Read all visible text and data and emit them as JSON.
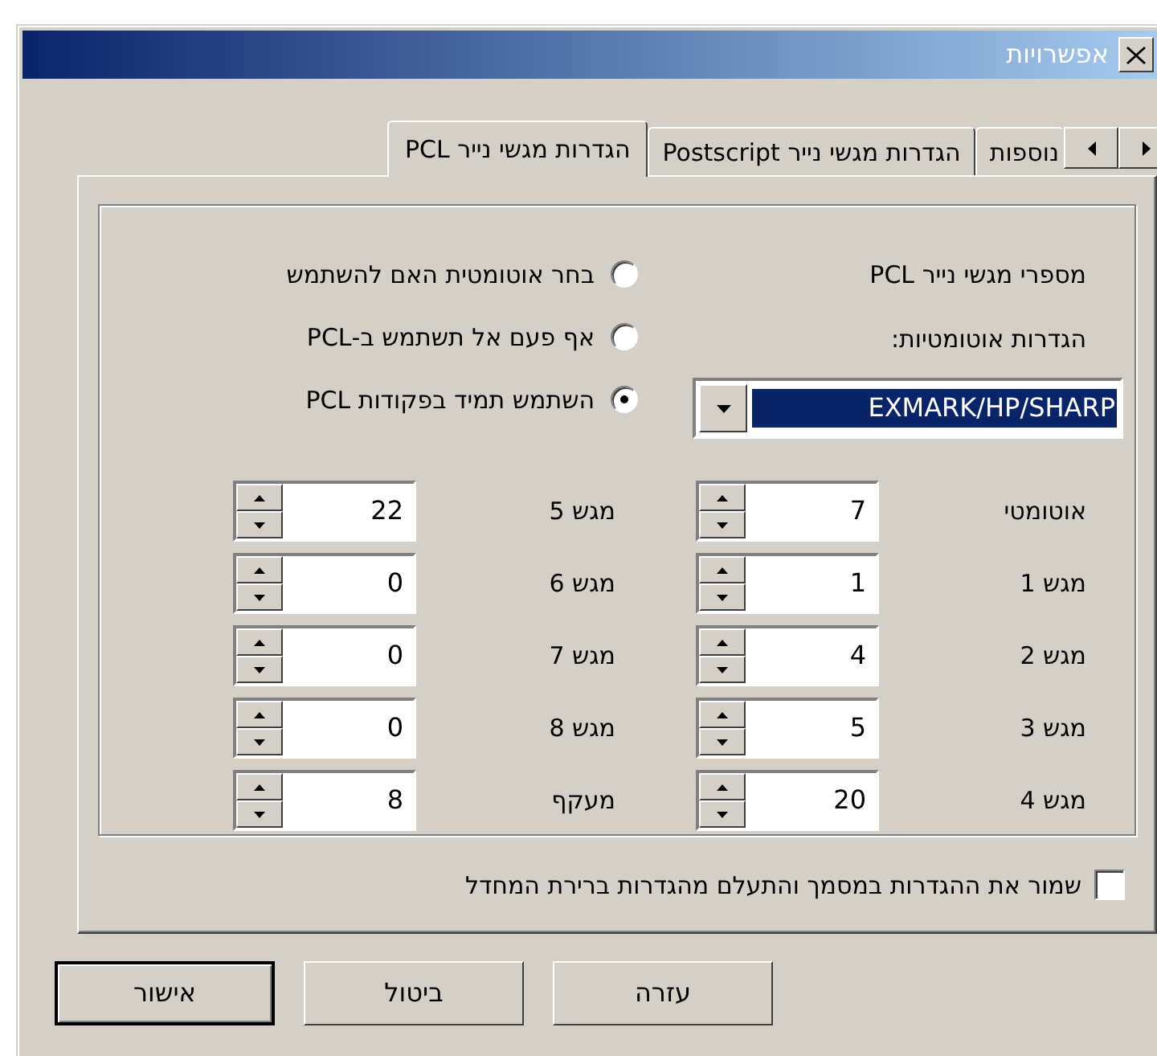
{
  "window": {
    "title": "אפשרויות"
  },
  "tabs": [
    {
      "label": "נוספות",
      "selected": false,
      "cut": true
    },
    {
      "label": "הגדרות מגשי נייר Postscript",
      "selected": false
    },
    {
      "label": "הגדרות מגשי נייר PCL",
      "selected": true
    }
  ],
  "tray_numbers": {
    "title": "מספרי מגשי נייר PCL",
    "auto_label": "הגדרות אוטומטיות:",
    "auto_select": "EXMARK/HP/SHARP",
    "options": [
      {
        "label": "בחר אוטומטית האם להשתמש",
        "selected": false
      },
      {
        "label": "אף פעם אל תשתמש ב-PCL",
        "selected": false
      },
      {
        "label": "השתמש תמיד בפקודות PCL",
        "selected": true
      }
    ]
  },
  "trays_right": [
    {
      "label": "אוטומטי",
      "value": "7"
    },
    {
      "label": "מגש 1",
      "value": "1"
    },
    {
      "label": "מגש 2",
      "value": "4"
    },
    {
      "label": "מגש 3",
      "value": "5"
    },
    {
      "label": "מגש 4",
      "value": "20"
    }
  ],
  "trays_left": [
    {
      "label": "מגש 5",
      "value": "22"
    },
    {
      "label": "מגש 6",
      "value": "0"
    },
    {
      "label": "מגש 7",
      "value": "0"
    },
    {
      "label": "מגש 8",
      "value": "0"
    },
    {
      "label": "מעקף",
      "value": "8"
    }
  ],
  "save_in_document": {
    "label": "שמור את ההגדרות במסמך והתעלם מהגדרות ברירת המחדל",
    "checked": false
  },
  "buttons": [
    {
      "label": "עזרה",
      "default": false
    },
    {
      "label": "ביטול",
      "default": false
    },
    {
      "label": "אישור",
      "default": true
    }
  ]
}
